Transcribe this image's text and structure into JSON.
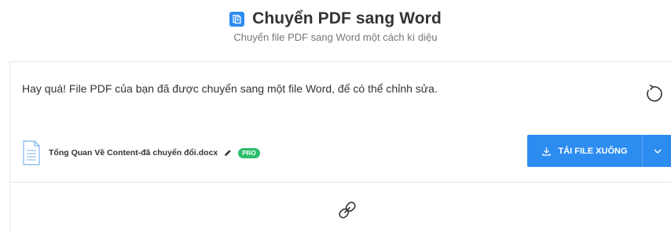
{
  "header": {
    "title": "Chuyển PDF sang Word",
    "subtitle": "Chuyển file PDF sang Word một cách kì diệu",
    "icon": "pdf-to-word-icon",
    "accent_color": "#2d8cf0"
  },
  "result": {
    "message": "Hay quá! File PDF của bạn đã được chuyển sang một file Word, để có thể chỉnh sửa.",
    "restart_icon": "restart-icon"
  },
  "file": {
    "name": "Tổng Quan Về Content-đã chuyển đổi.docx",
    "icon": "document-icon",
    "edit_icon": "pencil-icon",
    "badge": "PRO",
    "badge_color": "#2bbf6a"
  },
  "download": {
    "label": "TẢI FILE XUỐNG",
    "icon": "download-icon",
    "dropdown_icon": "chevron-down-icon"
  },
  "share": {
    "icon": "link-icon"
  }
}
